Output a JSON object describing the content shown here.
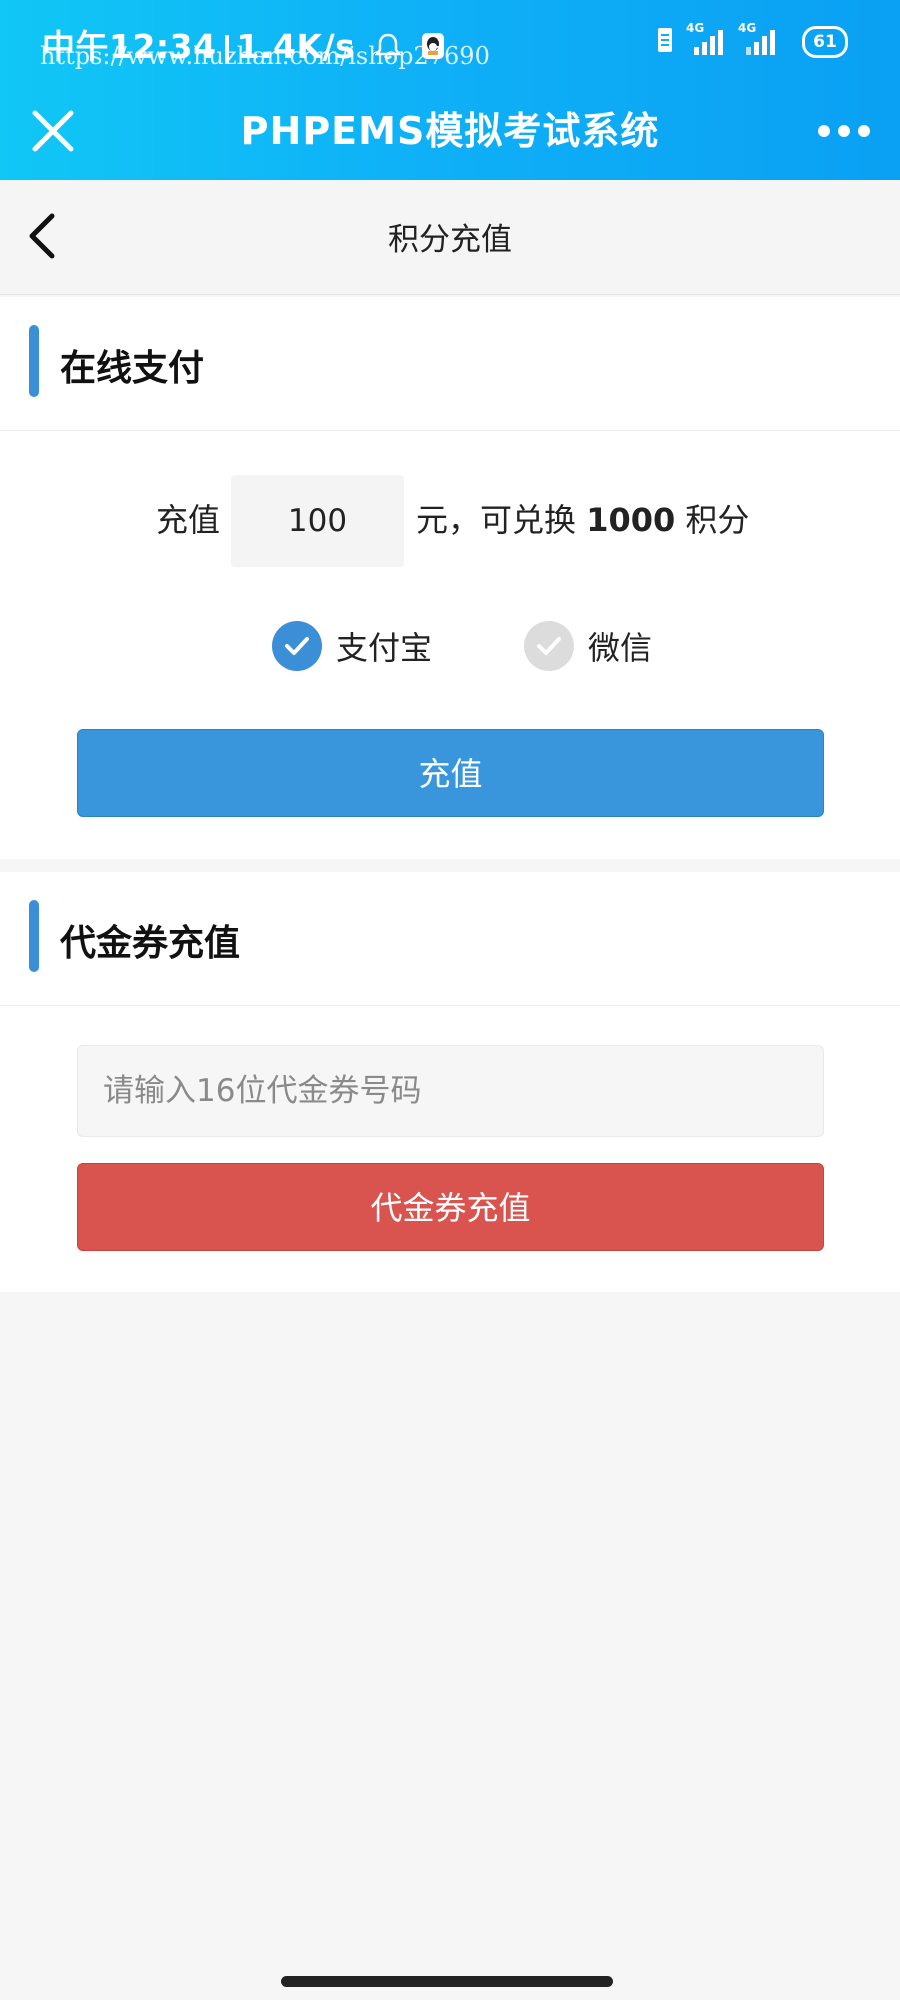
{
  "status_bar": {
    "time": "中午12:34",
    "speed": "1.4K/s",
    "battery": "61",
    "network_1": "4G",
    "network_2": "4G",
    "watermark": "https://www.huzhan.com/ishop27690"
  },
  "nav": {
    "title": "PHPEMS模拟考试系统"
  },
  "page": {
    "title": "积分充值"
  },
  "online_payment": {
    "section_title": "在线支付",
    "recharge_label": "充值",
    "amount_value": "100",
    "suffix_unit": "元，可兑换",
    "points_value": "1000",
    "points_unit": "积分",
    "methods": [
      {
        "label": "支付宝",
        "selected": true
      },
      {
        "label": "微信",
        "selected": false
      }
    ],
    "submit_label": "充值"
  },
  "voucher": {
    "section_title": "代金券充值",
    "input_placeholder": "请输入16位代金券号码",
    "input_value": "",
    "submit_label": "代金券充值"
  },
  "colors": {
    "accent_blue": "#3a96dc",
    "danger_red": "#d9534f",
    "header_gradient_start": "#10c7f6",
    "header_gradient_end": "#0aa0f3"
  },
  "icons": {
    "close": "close-icon",
    "more": "more-icon",
    "back": "chevron-left-icon",
    "check": "check-icon",
    "bell": "bell-icon",
    "qq": "qq-icon",
    "signal": "signal-icon",
    "sim": "sim-card-icon"
  }
}
